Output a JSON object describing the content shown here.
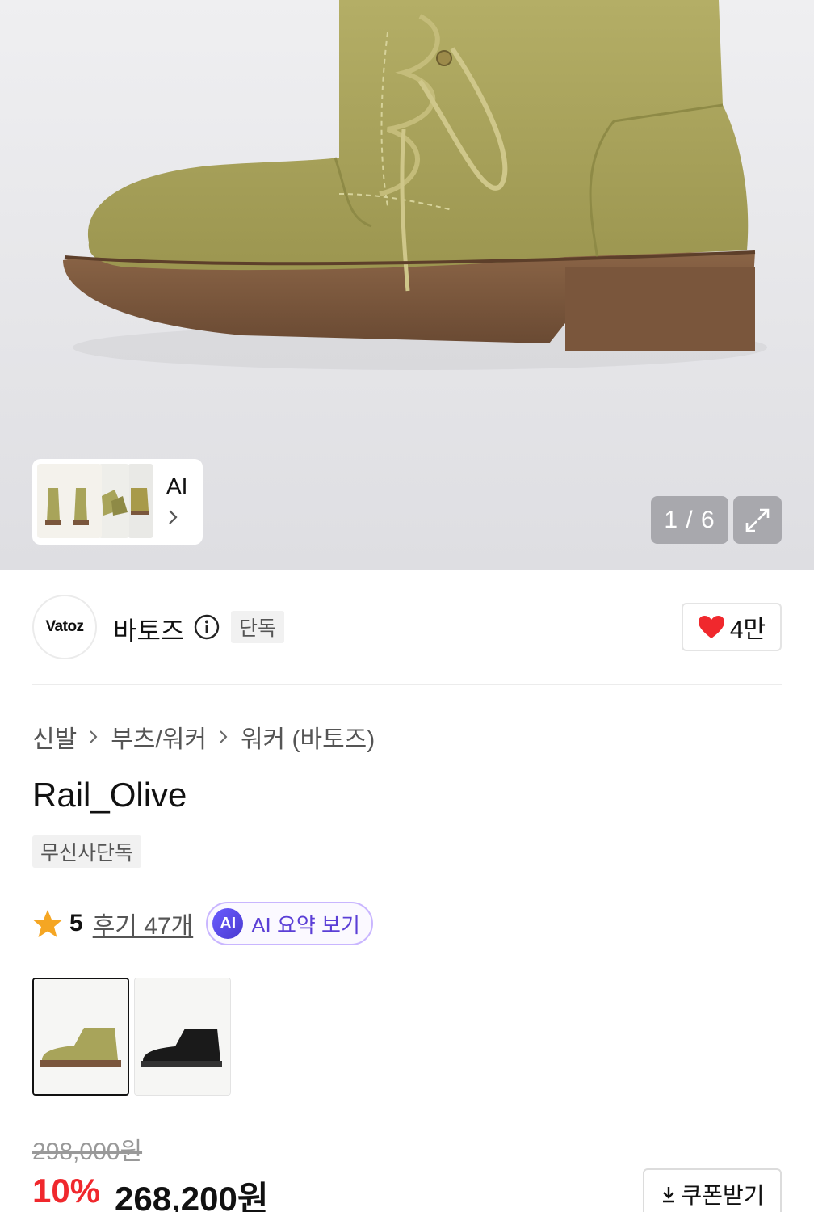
{
  "gallery": {
    "counter": "1 / 6",
    "ai_link_label": "AI",
    "expand_icon": "expand-icon"
  },
  "brand": {
    "logo_text": "Vatoz",
    "name": "바토즈",
    "exclusive_badge": "단독",
    "likes": "4만"
  },
  "breadcrumb": [
    "신발",
    "부츠/워커",
    "워커 (바토즈)"
  ],
  "product": {
    "title": "Rail_Olive",
    "tag": "무신사단독",
    "rating": "5",
    "reviews": "후기 47개",
    "ai_summary_badge": "AI",
    "ai_summary_label": "AI 요약 보기"
  },
  "price": {
    "original": "298,000원",
    "discount": "10%",
    "sale": "268,200원",
    "coupon_label": "쿠폰받기"
  },
  "colors": {
    "accent_red": "#f0282d",
    "ai_purple": "#5b3fd6",
    "boot_olive": "#a8a45a"
  }
}
